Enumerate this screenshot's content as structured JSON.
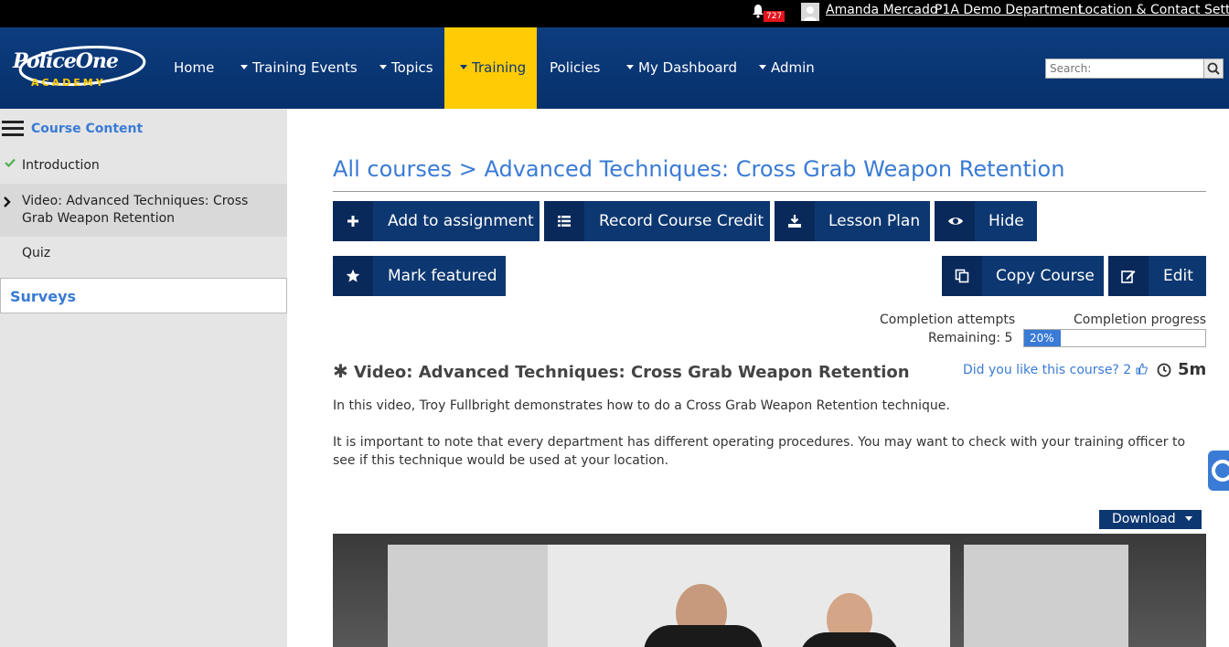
{
  "topbar": {
    "notification_count": "727",
    "user_name": "Amanda Mercado",
    "department": "P1A Demo Department",
    "location_settings": "Location & Contact Setting"
  },
  "nav": {
    "logo_top": "PoliceOne",
    "logo_bottom": "ACADEMY",
    "items": [
      {
        "label": "Home"
      },
      {
        "label": "Training Events"
      },
      {
        "label": "Topics"
      },
      {
        "label": "Training"
      },
      {
        "label": "Policies"
      },
      {
        "label": "My Dashboard"
      },
      {
        "label": "Admin"
      }
    ],
    "search_placeholder": "Search:"
  },
  "sidebar": {
    "header": "Course Content",
    "items": [
      {
        "label": "Introduction"
      },
      {
        "label": "Video: Advanced Techniques: Cross Grab Weapon Retention"
      },
      {
        "label": "Quiz"
      }
    ],
    "surveys": "Surveys"
  },
  "main": {
    "breadcrumb": "All courses > Advanced Techniques: Cross Grab Weapon Retention",
    "buttons": {
      "add_assignment": "Add to assignment",
      "record_credit": "Record Course Credit",
      "lesson_plan": "Lesson Plan",
      "hide": "Hide",
      "mark_featured": "Mark featured",
      "copy_course": "Copy Course",
      "edit": "Edit"
    },
    "completion_attempts_label": "Completion attempts",
    "remaining": "Remaining: 5",
    "completion_progress_label": "Completion progress",
    "progress_value": 20,
    "progress_text": "20%",
    "video_title": "Video: Advanced Techniques: Cross Grab Weapon Retention",
    "like_text": "Did you like this course? 2",
    "duration": "5m",
    "para1": "In this video, Troy Fullbright demonstrates how to do a Cross Grab Weapon Retention technique.",
    "para2": "It is important to note that every department has different operating procedures. You may want to check with your training officer to see if this technique would be used at your location.",
    "download": "Download"
  },
  "colors": {
    "nav_bg": "#0d3770",
    "active_tab": "#ffcb05",
    "link": "#3a7bd5"
  }
}
